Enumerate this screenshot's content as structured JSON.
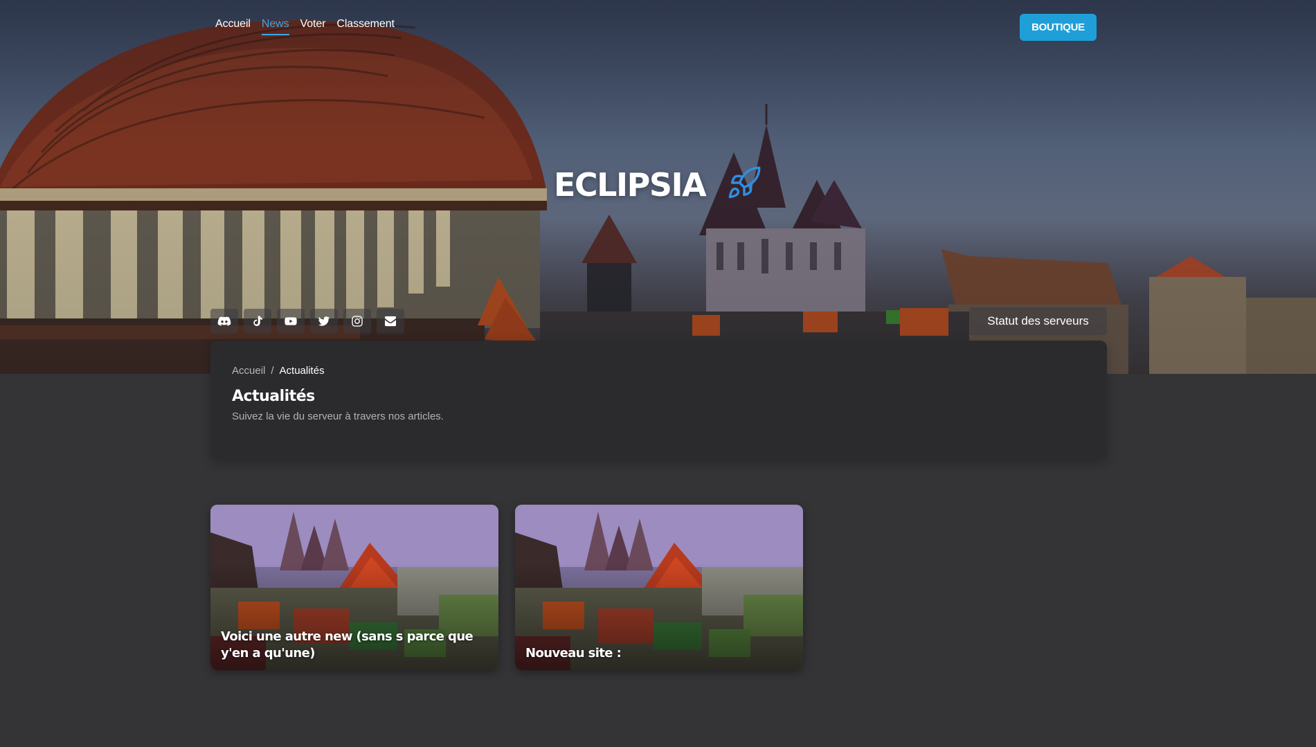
{
  "nav": {
    "items": [
      {
        "label": "Accueil",
        "active": false
      },
      {
        "label": "News",
        "active": true
      },
      {
        "label": "Voter",
        "active": false
      },
      {
        "label": "Classement",
        "active": false
      }
    ]
  },
  "header": {
    "shop_label": "BOUTIQUE",
    "brand": "ECLIPSIA",
    "brand_icon": "rocket-icon",
    "status_label": "Statut des serveurs"
  },
  "socials": [
    "discord-icon",
    "tiktok-icon",
    "youtube-icon",
    "twitter-icon",
    "instagram-icon",
    "envelope-icon"
  ],
  "page": {
    "breadcrumb": {
      "home": "Accueil",
      "separator": "/",
      "current": "Actualités"
    },
    "title": "Actualités",
    "subtitle": "Suivez la vie du serveur à travers nos articles."
  },
  "articles": [
    {
      "title": "Voici une autre new (sans s parce que y'en a qu'une)"
    },
    {
      "title": "Nouveau site :"
    }
  ],
  "colors": {
    "accent": "#3aa9e6",
    "shop_button": "#1f9fd7",
    "background": "#343436",
    "card": "#2b2b2d"
  }
}
